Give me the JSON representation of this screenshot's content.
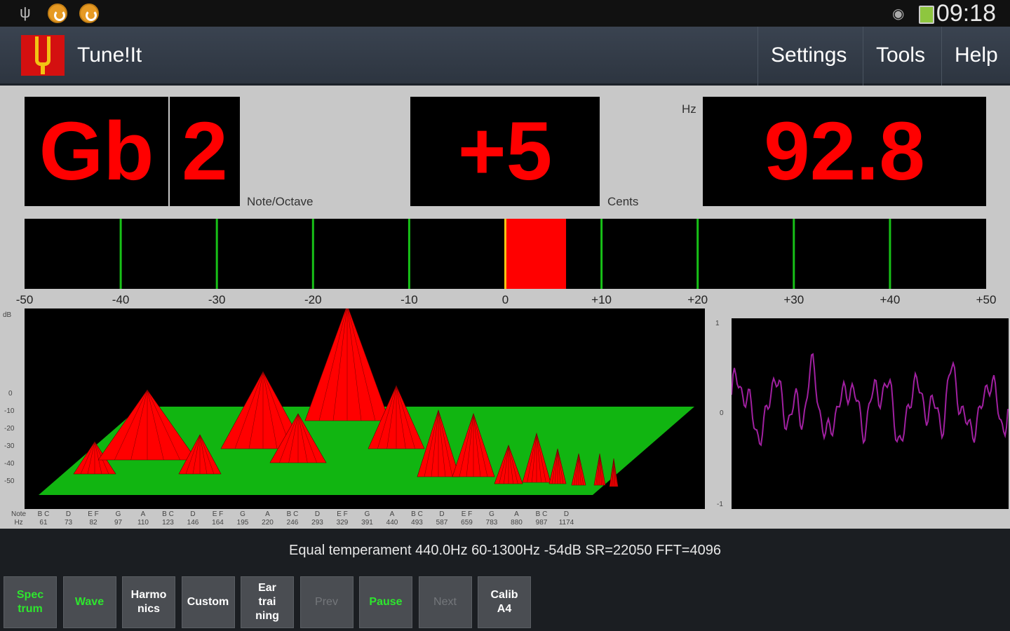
{
  "status_bar": {
    "time": "09:18",
    "icons": [
      "usb-icon",
      "app-notification-icon",
      "app-notification-icon",
      "eye-icon",
      "battery-charging-icon"
    ]
  },
  "app_bar": {
    "title": "Tune!It",
    "logo": "tuning-fork-icon",
    "menu": [
      "Settings",
      "Tools",
      "Help"
    ]
  },
  "readout": {
    "note": "Gb",
    "octave": "2",
    "note_octave_label": "Note/Octave",
    "cents": "+5",
    "cents_label": "Cents",
    "frequency": "92.8",
    "frequency_unit": "Hz",
    "text_color": "#ff0000"
  },
  "cents_meter": {
    "range": [
      -50,
      50
    ],
    "tick_labels": [
      "-50",
      "-40",
      "-30",
      "-20",
      "-10",
      "0",
      "+10",
      "+20",
      "+30",
      "+40",
      "+50"
    ],
    "gridline_values": [
      -40,
      -30,
      -20,
      -10,
      10,
      20,
      30,
      40
    ],
    "gridline_color": "#17c017",
    "indicator_value": 5,
    "indicator_color": "#ff0000",
    "center_line_color": "#f2c314"
  },
  "spectrum": {
    "db_label": "dB",
    "db_ticks": [
      "0",
      "-10",
      "-20",
      "-30",
      "-40",
      "-50"
    ],
    "note_axis_label": "Note",
    "hz_axis_label": "Hz",
    "notes": [
      {
        "n": "B C",
        "hz": "61"
      },
      {
        "n": "D",
        "hz": "73"
      },
      {
        "n": "E F",
        "hz": "82"
      },
      {
        "n": "G",
        "hz": "97"
      },
      {
        "n": "A",
        "hz": "110"
      },
      {
        "n": "B C",
        "hz": "123"
      },
      {
        "n": "D",
        "hz": "146"
      },
      {
        "n": "E F",
        "hz": "164"
      },
      {
        "n": "G",
        "hz": "195"
      },
      {
        "n": "A",
        "hz": "220"
      },
      {
        "n": "B C",
        "hz": "246"
      },
      {
        "n": "D",
        "hz": "293"
      },
      {
        "n": "E F",
        "hz": "329"
      },
      {
        "n": "G",
        "hz": "391"
      },
      {
        "n": "A",
        "hz": "440"
      },
      {
        "n": "B C",
        "hz": "493"
      },
      {
        "n": "D",
        "hz": "587"
      },
      {
        "n": "E F",
        "hz": "659"
      },
      {
        "n": "G",
        "hz": "783"
      },
      {
        "n": "A",
        "hz": "880"
      },
      {
        "n": "B C",
        "hz": "987"
      },
      {
        "n": "D",
        "hz": "1174"
      }
    ],
    "plane_color": "#11b511",
    "peak_color": "#ff0000"
  },
  "waveform": {
    "ticks": [
      "1",
      "0",
      "-1"
    ],
    "line_color": "#a020a0"
  },
  "info_line": "Equal temperament   440.0Hz   60-1300Hz   -54dB  SR=22050 FFT=4096",
  "toolbar": [
    {
      "label": "Spec\ntrum",
      "state": "active"
    },
    {
      "label": "Wave",
      "state": "active"
    },
    {
      "label": "Harmo\nnics",
      "state": "normal"
    },
    {
      "label": "Custom",
      "state": "normal"
    },
    {
      "label": "Ear\ntrai\nning",
      "state": "normal"
    },
    {
      "label": "Prev",
      "state": "disabled"
    },
    {
      "label": "Pause",
      "state": "active"
    },
    {
      "label": "Next",
      "state": "disabled"
    },
    {
      "label": "Calib\nA4",
      "state": "normal"
    }
  ]
}
